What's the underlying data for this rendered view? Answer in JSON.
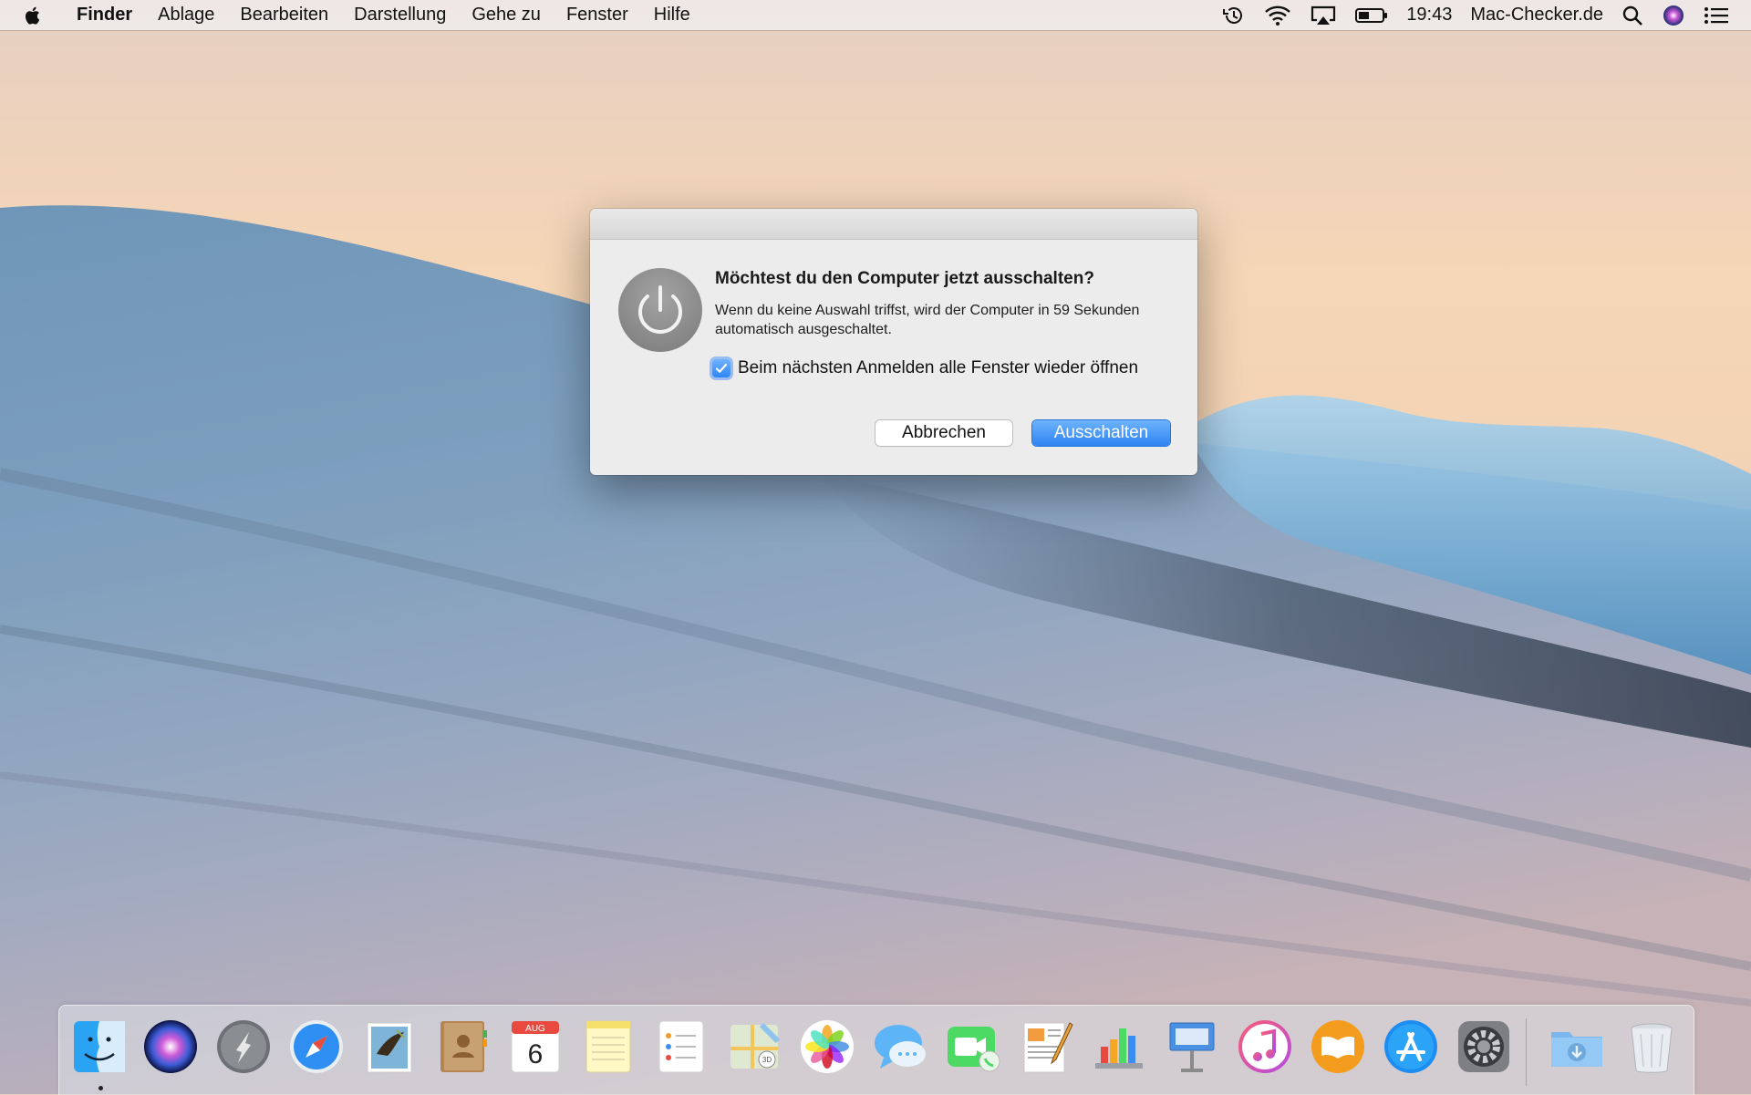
{
  "menubar": {
    "app_name": "Finder",
    "menus": [
      "Ablage",
      "Bearbeiten",
      "Darstellung",
      "Gehe zu",
      "Fenster",
      "Hilfe"
    ],
    "clock": "19:43",
    "user": "Mac-Checker.de",
    "status_icons": [
      "time-machine-icon",
      "wifi-icon",
      "airplay-icon",
      "battery-icon",
      "spotlight-icon",
      "siri-icon",
      "notification-center-icon"
    ]
  },
  "dialog": {
    "title": "Möchtest du den Computer jetzt ausschalten?",
    "message": "Wenn du keine Auswahl triffst, wird der Computer in 59 Sekunden automatisch ausgeschaltet.",
    "checkbox_label": "Beim nächsten Anmelden alle Fenster wieder öffnen",
    "checkbox_checked": true,
    "cancel_label": "Abbrechen",
    "confirm_label": "Ausschalten",
    "accent_color": "#2f84f4"
  },
  "dock": {
    "calendar_month": "AUG",
    "calendar_day": "6",
    "apps": [
      "finder",
      "siri",
      "launchpad",
      "safari",
      "mail",
      "contacts",
      "calendar",
      "notes",
      "reminders",
      "maps",
      "photos",
      "messages",
      "facetime",
      "pages",
      "numbers",
      "keynote",
      "itunes",
      "ibooks",
      "app-store",
      "system-preferences",
      "downloads",
      "trash"
    ]
  }
}
